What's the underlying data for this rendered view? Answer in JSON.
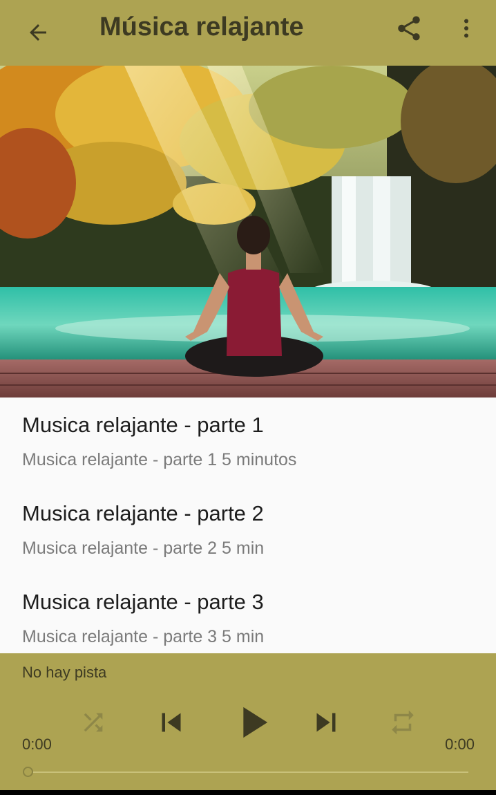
{
  "appbar": {
    "title": "Música relajante",
    "icons": [
      "arrow-back-icon",
      "share-icon",
      "more-vert-icon"
    ],
    "color": "#ada352"
  },
  "hero": {
    "icon": "meditation-waterfall-image"
  },
  "tracks": [
    {
      "title": "Musica relajante - parte 1",
      "subtitle": "Musica relajante - parte 1 5 minutos"
    },
    {
      "title": "Musica relajante - parte 2",
      "subtitle": "Musica relajante - parte 2 5 min"
    },
    {
      "title": "Musica relajante - parte 3",
      "subtitle": "Musica relajante - parte 3 5 min"
    }
  ],
  "player": {
    "status": "No hay pista",
    "elapsed": "0:00",
    "duration": "0:00",
    "progress": 0,
    "controls": [
      "shuffle-icon",
      "skip-previous-icon",
      "play-icon",
      "skip-next-icon",
      "repeat-icon"
    ]
  }
}
